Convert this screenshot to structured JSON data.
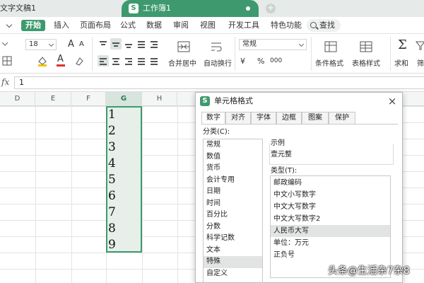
{
  "tabs": {
    "doc1": "文字文稿1",
    "workbook": "工作簿1",
    "workbook_badge": "S",
    "add": "+"
  },
  "menu": {
    "items": [
      "开始",
      "插入",
      "页面布局",
      "公式",
      "数据",
      "审阅",
      "视图",
      "开发工具",
      "特色功能"
    ],
    "search": "查找"
  },
  "ribbon": {
    "font_size": "18",
    "number_format": "常规",
    "merge_center": "合并居中",
    "auto_wrap": "自动换行",
    "currency_symbol": "¥",
    "percent_symbol": "%",
    "thousands": "000",
    "conditional_format": "条件格式",
    "table_style": "表格样式",
    "sum": "求和",
    "filter": "筛",
    "font_grow": "A",
    "font_shrink": "A",
    "font_color": "A"
  },
  "formula": {
    "fx": "fx",
    "value": "1"
  },
  "columns": [
    "D",
    "E",
    "F",
    "G",
    "H"
  ],
  "cells_g": [
    "1",
    "2",
    "3",
    "4",
    "5",
    "6",
    "7",
    "8",
    "9"
  ],
  "dialog": {
    "icon": "S",
    "title": "单元格格式",
    "close": "×",
    "tabs": [
      "数字",
      "对齐",
      "字体",
      "边框",
      "图案",
      "保护"
    ],
    "category_label": "分类(C):",
    "categories": [
      "常规",
      "数值",
      "货币",
      "会计专用",
      "日期",
      "时间",
      "百分比",
      "分数",
      "科学记数",
      "文本",
      "特殊",
      "自定义"
    ],
    "selected_category": "特殊",
    "sample_label": "示例",
    "sample_value": "壹元整",
    "type_label": "类型(T):",
    "types": [
      "邮政编码",
      "中文小写数字",
      "中文大写数字",
      "中文大写数字2",
      "人民币大写",
      "单位：万元",
      "正负号"
    ],
    "selected_type": "人民币大写"
  },
  "watermark": "头条@生活杂7杂8",
  "colors": {
    "accent": "#3e9a6e",
    "selection_fill": "#e6efea",
    "titlebar": "#e6ebea"
  }
}
